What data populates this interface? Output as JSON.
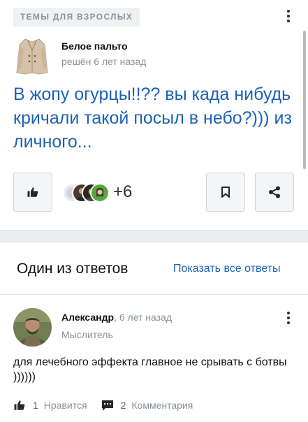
{
  "question_card": {
    "category": "ТЕМЫ ДЛЯ ВЗРОСЛЫХ",
    "author": {
      "name": "Белое пальто",
      "status": "решён 6 лет назад"
    },
    "title": "В жопу огурцы!!?? вы када нибудь кричали такой посыл в небо?))) из личного...",
    "likers_more": "+6",
    "icons": {
      "menu": "more-vertical-icon",
      "like": "thumbs-up-icon",
      "bookmark": "bookmark-icon",
      "share": "share-icon"
    }
  },
  "answers": {
    "heading": "Один из ответов",
    "show_all_link": "Показать все ответы",
    "answer": {
      "author_name": "Александр",
      "time": ", 6 лет назад",
      "rank": "Мыслитель",
      "text": "для лечебного эффекта главное не срывать с ботвы ))))))",
      "likes_count": "1",
      "likes_label": "Нравится",
      "comments_count": "2",
      "comments_label": "Комментария"
    }
  },
  "colors": {
    "link": "#1b62b8",
    "muted": "#8a9099",
    "page_bg": "#ebedf0"
  }
}
